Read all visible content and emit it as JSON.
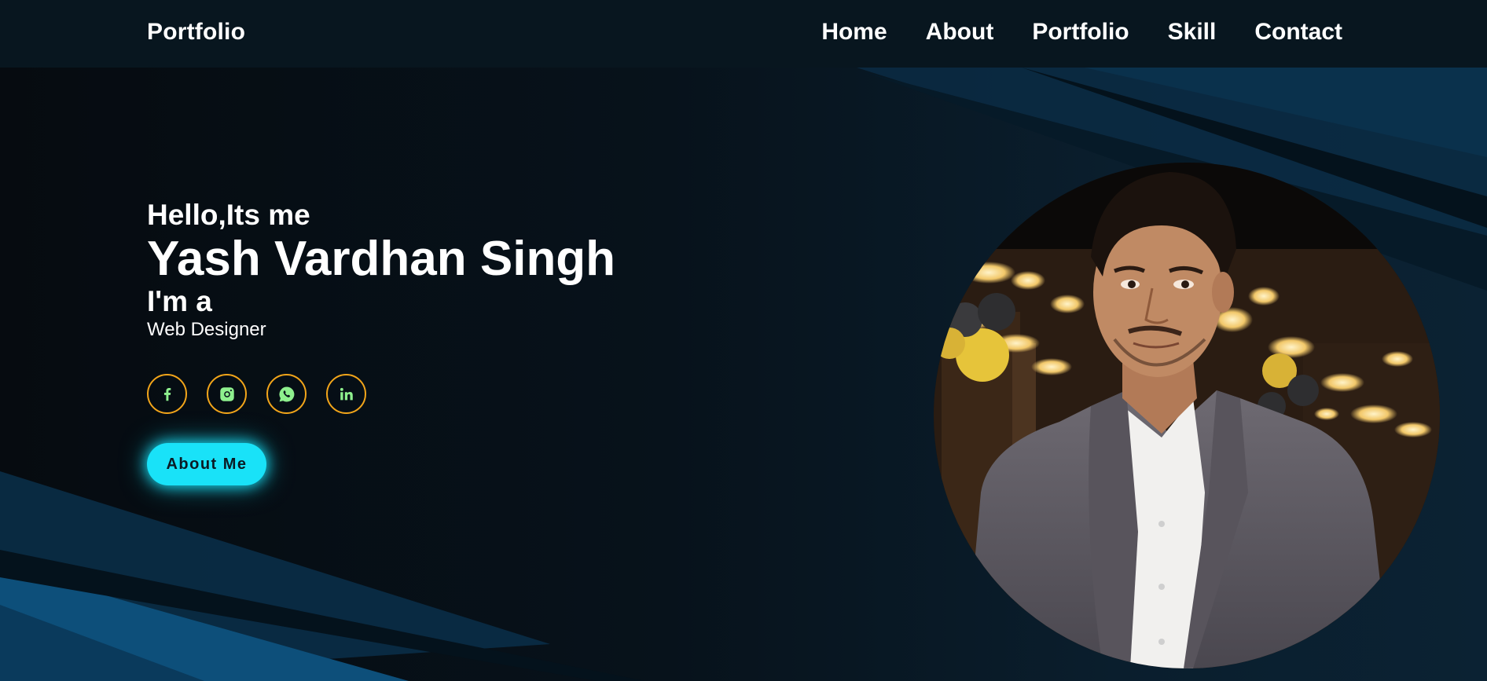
{
  "navbar": {
    "logo": "Portfolio",
    "links": [
      {
        "label": "Home"
      },
      {
        "label": "About"
      },
      {
        "label": "Portfolio"
      },
      {
        "label": "Skill"
      },
      {
        "label": "Contact"
      }
    ]
  },
  "hero": {
    "greeting": "Hello,Its me",
    "name": "Yash Vardhan Singh",
    "intro": "I'm a",
    "role": "Web Designer",
    "socials": [
      {
        "icon": "facebook-icon"
      },
      {
        "icon": "instagram-icon"
      },
      {
        "icon": "whatsapp-icon"
      },
      {
        "icon": "linkedin-icon"
      }
    ],
    "cta_label": "About Me"
  },
  "colors": {
    "accent": "#19e2f8",
    "social_border": "#f2a51a",
    "social_icon": "#8ef08e",
    "nav_bg": "#08161f"
  }
}
